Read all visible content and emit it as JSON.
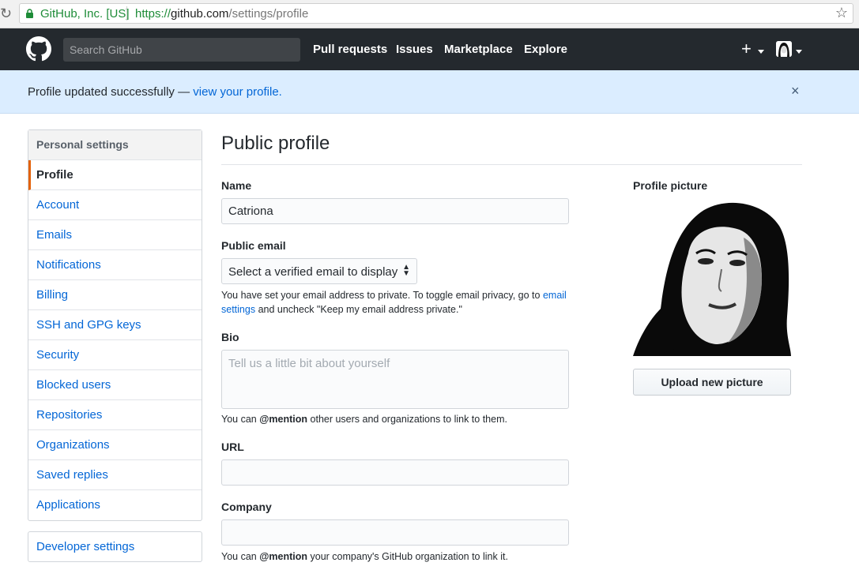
{
  "browser": {
    "site_identity": "GitHub, Inc. [US]",
    "url_scheme": "https://",
    "url_host": "github.com",
    "url_path": "/settings/profile"
  },
  "header": {
    "search_placeholder": "Search GitHub",
    "nav": [
      "Pull requests",
      "Issues",
      "Marketplace",
      "Explore"
    ],
    "plus_label": "+"
  },
  "flash": {
    "message": "Profile updated successfully —",
    "link": "view your profile.",
    "close": "×"
  },
  "sidebar": {
    "heading": "Personal settings",
    "items": [
      {
        "label": "Profile",
        "selected": true
      },
      {
        "label": "Account"
      },
      {
        "label": "Emails"
      },
      {
        "label": "Notifications"
      },
      {
        "label": "Billing"
      },
      {
        "label": "SSH and GPG keys"
      },
      {
        "label": "Security"
      },
      {
        "label": "Blocked users"
      },
      {
        "label": "Repositories"
      },
      {
        "label": "Organizations"
      },
      {
        "label": "Saved replies"
      },
      {
        "label": "Applications"
      }
    ],
    "developer": "Developer settings"
  },
  "main": {
    "title": "Public profile",
    "name_label": "Name",
    "name_value": "Catriona",
    "email_label": "Public email",
    "email_select": "Select a verified email to display",
    "email_note_pre": "You have set your email address to private. To toggle email privacy, go to",
    "email_note_link1": "email",
    "email_note_link2": "settings",
    "email_note_post": "and uncheck \"Keep my email address private.\"",
    "bio_label": "Bio",
    "bio_placeholder": "Tell us a little bit about yourself",
    "bio_note_pre": "You can",
    "bio_note_mention": "@mention",
    "bio_note_post": "other users and organizations to link to them.",
    "url_label": "URL",
    "company_label": "Company",
    "company_note_pre": "You can",
    "company_note_mention": "@mention",
    "company_note_post": "your company's GitHub organization to link it."
  },
  "picture": {
    "label": "Profile picture",
    "upload": "Upload new picture"
  },
  "colors": {
    "header_bg": "#24292e",
    "link": "#0366d6",
    "flash_bg": "#dbedff",
    "selected_border": "#e36209"
  }
}
